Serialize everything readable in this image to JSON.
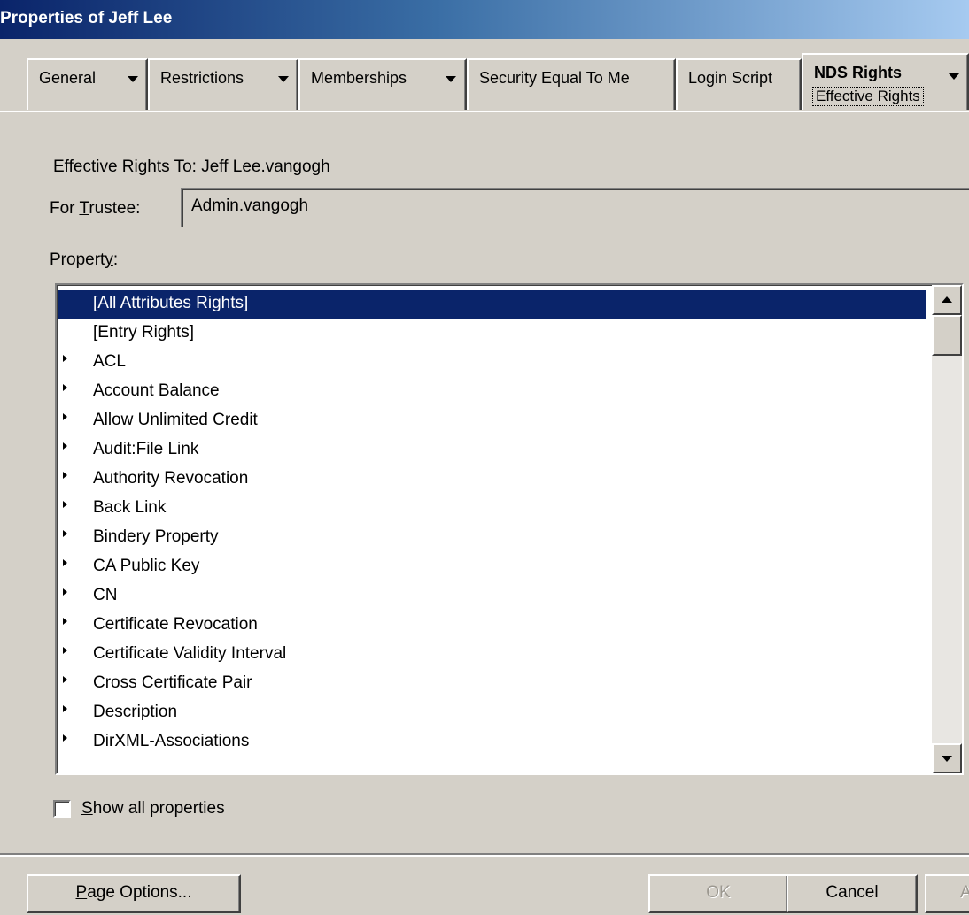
{
  "window": {
    "title": "Properties of Jeff Lee"
  },
  "tabs": [
    {
      "label": "General",
      "has_menu": true
    },
    {
      "label": "Restrictions",
      "has_menu": true
    },
    {
      "label": "Memberships",
      "has_menu": true
    },
    {
      "label": "Security Equal To Me",
      "has_menu": false
    },
    {
      "label": "Login Script",
      "has_menu": false
    },
    {
      "label": "NDS Rights",
      "has_menu": true,
      "active": true,
      "subpage": "Effective Rights"
    }
  ],
  "panel": {
    "effective_rights_label": "Effective Rights To: Jeff Lee.vangogh",
    "trustee_label_prefix": "For ",
    "trustee_label_mnemonic": "T",
    "trustee_label_rest": "rustee:",
    "trustee_value": "Admin.vangogh",
    "property_label_prefix": "Propert",
    "property_label_mnemonic": "y",
    "property_label_suffix": ":",
    "properties": [
      {
        "name": "[All Attributes Rights]",
        "marker": false,
        "selected": true
      },
      {
        "name": "[Entry Rights]",
        "marker": false
      },
      {
        "name": "ACL",
        "marker": true
      },
      {
        "name": "Account Balance",
        "marker": true
      },
      {
        "name": "Allow Unlimited Credit",
        "marker": true
      },
      {
        "name": "Audit:File Link",
        "marker": true
      },
      {
        "name": "Authority Revocation",
        "marker": true
      },
      {
        "name": "Back Link",
        "marker": true
      },
      {
        "name": "Bindery Property",
        "marker": true
      },
      {
        "name": "CA Public Key",
        "marker": true
      },
      {
        "name": "CN",
        "marker": true
      },
      {
        "name": "Certificate Revocation",
        "marker": true
      },
      {
        "name": "Certificate Validity Interval",
        "marker": true
      },
      {
        "name": "Cross Certificate Pair",
        "marker": true
      },
      {
        "name": "Description",
        "marker": true
      },
      {
        "name": "DirXML-Associations",
        "marker": true
      }
    ],
    "show_all_mnemonic": "S",
    "show_all_rest": "how all properties",
    "show_all_checked": false
  },
  "buttons": {
    "page_options_mnemonic": "P",
    "page_options_rest": "age Options...",
    "ok": "OK",
    "ok_enabled": false,
    "cancel": "Cancel",
    "apply_partial": "A"
  },
  "colors": {
    "face": "#d4d0c8",
    "title_gradient_start": "#0a246a",
    "selection": "#0a246a"
  }
}
